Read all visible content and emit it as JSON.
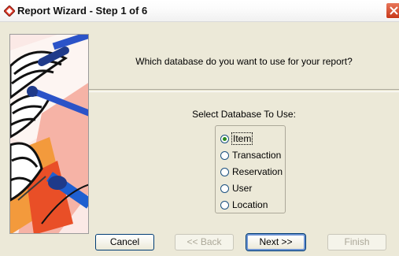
{
  "window": {
    "title": "Report Wizard - Step 1 of 6"
  },
  "main": {
    "question": "Which database do you want to use for your report?",
    "select_label": "Select Database To Use:",
    "options": [
      {
        "label": "Item",
        "selected": true
      },
      {
        "label": "Transaction",
        "selected": false
      },
      {
        "label": "Reservation",
        "selected": false
      },
      {
        "label": "User",
        "selected": false
      },
      {
        "label": "Location",
        "selected": false
      }
    ]
  },
  "buttons": {
    "cancel": "Cancel",
    "back": "<< Back",
    "next": "Next >>",
    "finish": "Finish"
  },
  "colors": {
    "accent": "#6c93d3",
    "close": "#c8391a",
    "radio_dot": "#2a8a1d"
  }
}
